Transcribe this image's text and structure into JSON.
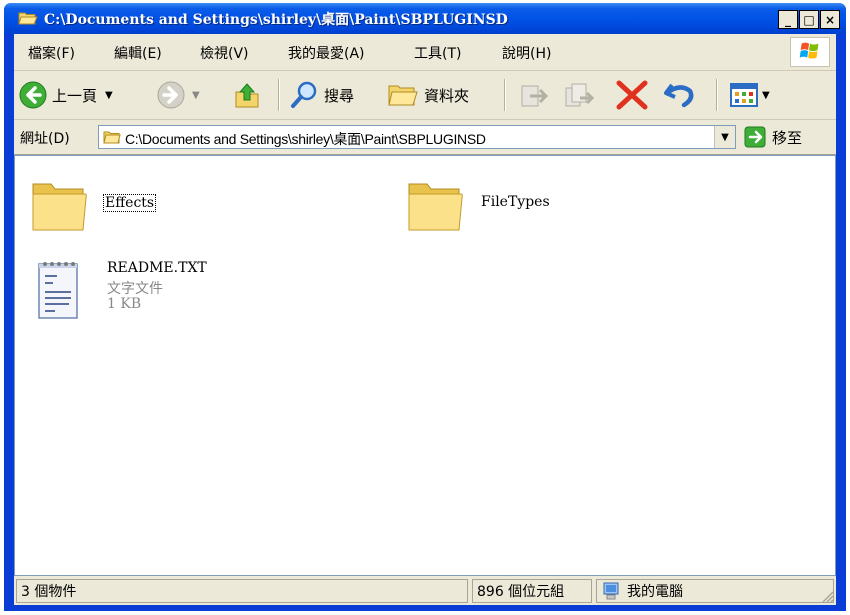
{
  "window": {
    "title": "C:\\Documents and Settings\\shirley\\桌面\\Paint\\SBPLUGINSD",
    "minimize_label": "_",
    "maximize_label": "□",
    "close_label": "×"
  },
  "menu": {
    "items": [
      "檔案(F)",
      "編輯(E)",
      "檢視(V)",
      "我的最愛(A)",
      "工具(T)",
      "說明(H)"
    ]
  },
  "toolbar": {
    "back_label": "上一頁",
    "search_label": "搜尋",
    "folders_label": "資料夾"
  },
  "address": {
    "label": "網址(D)",
    "value": "C:\\Documents and Settings\\shirley\\桌面\\Paint\\SBPLUGINSD",
    "go_label": "移至"
  },
  "files": [
    {
      "name": "Effects",
      "type": "folder"
    },
    {
      "name": "FileTypes",
      "type": "folder"
    },
    {
      "name": "README.TXT",
      "type": "text",
      "kind": "文字文件",
      "size": "1 KB"
    }
  ],
  "status": {
    "objects": "3 個物件",
    "size": "896 個位元組",
    "location": "我的電腦"
  },
  "colors": {
    "titlebar": "#0051e6",
    "chrome": "#ece9d8",
    "folder": "#f7dc7a"
  }
}
